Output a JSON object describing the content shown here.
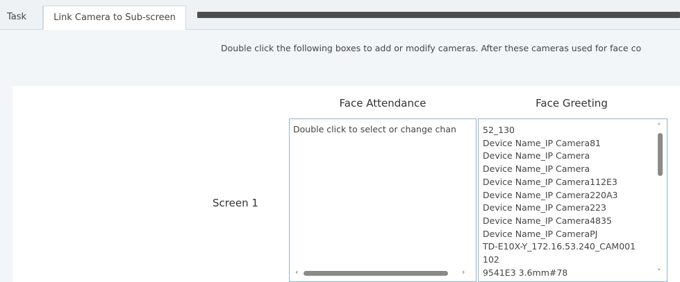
{
  "tabs": {
    "task": "Task",
    "link_camera": "Link Camera to Sub-screen"
  },
  "info_text": "Double click the following boxes to add or modify cameras. After these cameras used for face co",
  "columns": {
    "face_attendance": "Face Attendance",
    "face_greeting": "Face Greeting"
  },
  "screen_label": "Screen 1",
  "attendance_box": {
    "placeholder": "Double click to select or change chan"
  },
  "greeting_box": {
    "items": [
      "52_130",
      "Device Name_IP Camera81",
      "Device Name_IP Camera",
      "Device Name_IP Camera",
      "Device Name_IP Camera112E3",
      "Device Name_IP Camera220A3",
      "Device Name_IP Camera223",
      "Device Name_IP Camera4835",
      "Device Name_IP CameraPJ",
      "TD-E10X-Y_172.16.53.240_CAM001",
      "102",
      "9541E3 3.6mm#78"
    ]
  },
  "icons": {
    "scroll_left": "‹",
    "scroll_right": "›",
    "scroll_up": "˄",
    "scroll_down": "˅"
  },
  "colors": {
    "list_border": "#8fb4c6",
    "active_tab_bg": "#ffffff",
    "redaction_bar": "#4d4d4d"
  }
}
